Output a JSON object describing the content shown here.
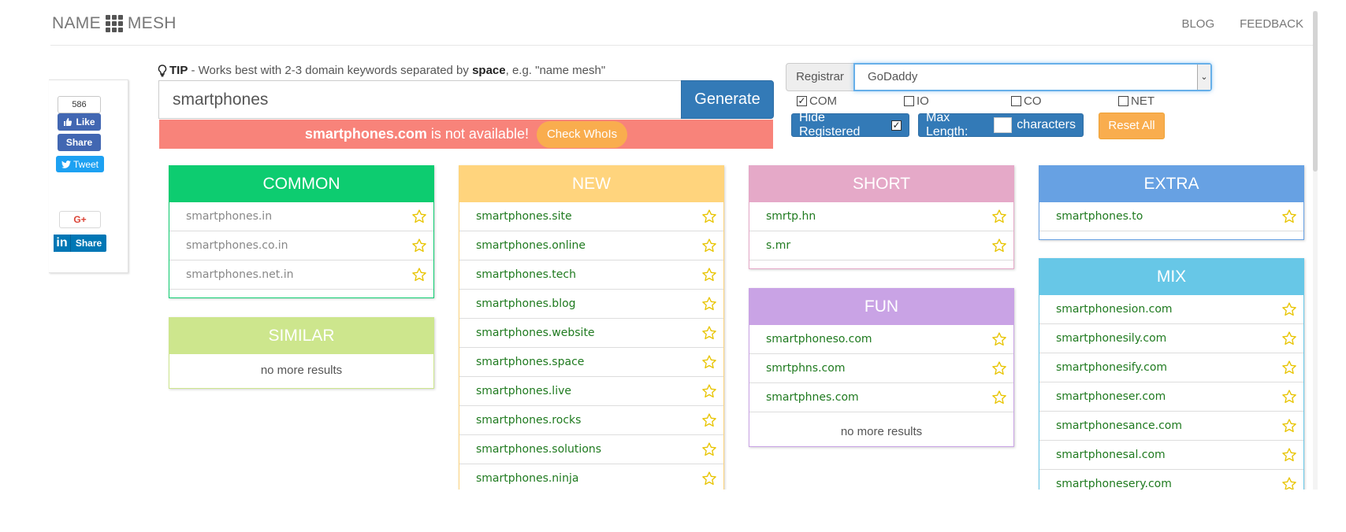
{
  "brand": {
    "name_left": "NAME",
    "name_right": "MESH"
  },
  "nav": {
    "blog": "BLOG",
    "feedback": "FEEDBACK"
  },
  "social": {
    "fb_count": "586",
    "fb_like": "Like",
    "fb_share": "Share",
    "tweet": "Tweet",
    "gplus": "G+",
    "li_icon": "in",
    "li_share": "Share"
  },
  "tip": {
    "label": "TIP",
    "text_before": " - Works best with 2-3 domain keywords separated by ",
    "emph": "space",
    "text_after": ", e.g. \"name mesh\""
  },
  "search": {
    "value": "smartphones",
    "generate_label": "Generate"
  },
  "alert": {
    "domain": "smartphones.com",
    "message": "is not available!",
    "whois_label": "Check WhoIs"
  },
  "registrar": {
    "label": "Registrar",
    "selected": "GoDaddy"
  },
  "tlds": [
    {
      "label": "COM",
      "checked": true
    },
    {
      "label": "IO",
      "checked": false
    },
    {
      "label": "CO",
      "checked": false
    },
    {
      "label": "NET",
      "checked": false
    }
  ],
  "filters": {
    "hide_registered": "Hide Registered",
    "max_length": "Max Length:",
    "characters": "characters",
    "reset": "Reset All"
  },
  "colors": {
    "common": "#0dcc70",
    "similar": "#cde68d",
    "new": "#ffd47d",
    "short": "#e5a9c8",
    "fun": "#c9a3e5",
    "extra": "#67a1e3",
    "mix": "#67c7e7",
    "primary": "#337ab7",
    "warning": "#f9ad4e",
    "danger": "#f8837a"
  },
  "panels": {
    "common": {
      "title": "COMMON",
      "items": [
        "smartphones.in",
        "smartphones.co.in",
        "smartphones.net.in"
      ]
    },
    "similar": {
      "title": "SIMILAR",
      "more": "no more results"
    },
    "new": {
      "title": "NEW",
      "items": [
        "smartphones.site",
        "smartphones.online",
        "smartphones.tech",
        "smartphones.blog",
        "smartphones.website",
        "smartphones.space",
        "smartphones.live",
        "smartphones.rocks",
        "smartphones.solutions",
        "smartphones.ninja"
      ]
    },
    "short": {
      "title": "SHORT",
      "items": [
        "smrtp.hn",
        "s.mr"
      ]
    },
    "fun": {
      "title": "FUN",
      "items": [
        "smartphoneso.com",
        "smrtphns.com",
        "smartphnes.com"
      ],
      "more": "no more results"
    },
    "extra": {
      "title": "EXTRA",
      "items": [
        "smartphones.to"
      ]
    },
    "mix": {
      "title": "MIX",
      "items": [
        "smartphonesion.com",
        "smartphonesily.com",
        "smartphonesify.com",
        "smartphoneser.com",
        "smartphonesance.com",
        "smartphonesal.com",
        "smartphonesery.com"
      ]
    }
  }
}
